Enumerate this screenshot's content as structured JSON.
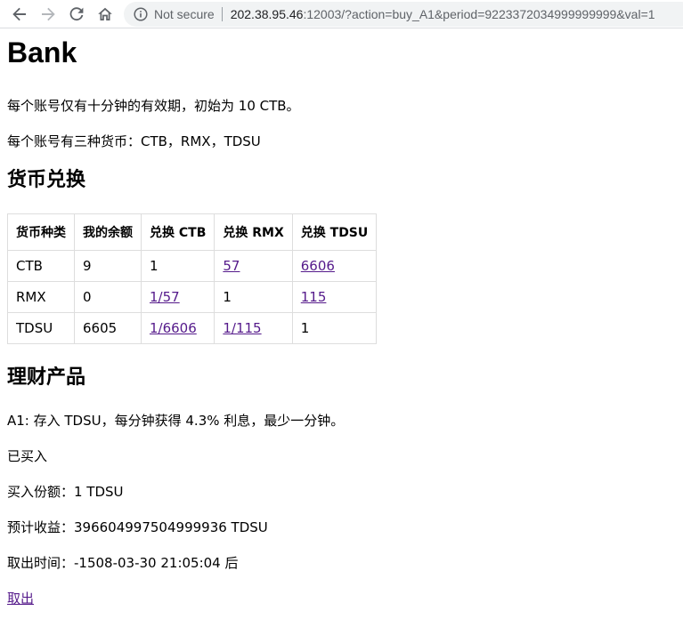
{
  "browser": {
    "security_label": "Not secure",
    "url_host": "202.38.95.46",
    "url_rest": ":12003/?action=buy_A1&period=9223372034999999999&val=1"
  },
  "page": {
    "title": "Bank",
    "intro_line1": "每个账号仅有十分钟的有效期，初始为 10 CTB。",
    "intro_line2": "每个账号有三种货币：CTB，RMX，TDSU"
  },
  "exchange": {
    "heading": "货币兑换",
    "headers": [
      "货币种类",
      "我的余额",
      "兑换 CTB",
      "兑换 RMX",
      "兑换 TDSU"
    ],
    "rows": [
      {
        "currency": "CTB",
        "balance": "9",
        "to_ctb": "1",
        "to_rmx": "57",
        "to_tdsu": "6606"
      },
      {
        "currency": "RMX",
        "balance": "0",
        "to_ctb": "1/57",
        "to_rmx": "1",
        "to_tdsu": "115"
      },
      {
        "currency": "TDSU",
        "balance": "6605",
        "to_ctb": "1/6606",
        "to_rmx": "1/115",
        "to_tdsu": "1"
      }
    ]
  },
  "finance": {
    "heading": "理财产品",
    "product": "A1: 存入 TDSU，每分钟获得 4.3% 利息，最少一分钟。",
    "status": "已买入",
    "amount": "买入份额：1 TDSU",
    "expected": "预计收益：396604997504999936 TDSU",
    "withdraw_time": "取出时间：-1508-03-30 21:05:04 后",
    "withdraw_link": "取出"
  }
}
